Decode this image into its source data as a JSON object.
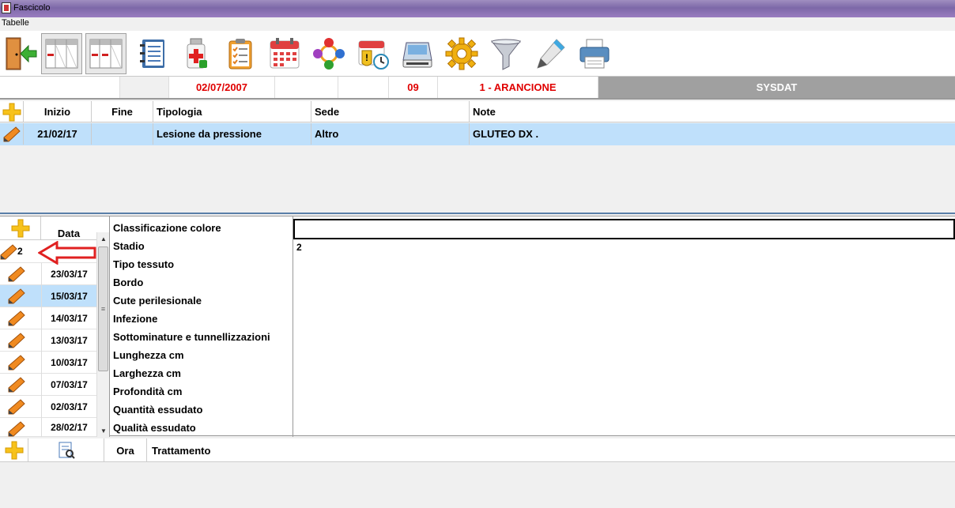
{
  "window": {
    "title": "Fascicolo"
  },
  "menu": {
    "tabelle": "Tabelle"
  },
  "toolbar": {
    "buttons": [
      "exit-icon",
      "grid-remove-icon",
      "grid-remove-icon",
      "notebook-icon",
      "medicine-bottle-icon",
      "clipboard-checklist-icon",
      "calendar-icon",
      "people-network-icon",
      "calendar-alert-clock-icon",
      "scanner-icon",
      "gear-icon",
      "filter-icon",
      "pen-icon",
      "printer-icon"
    ]
  },
  "info": {
    "date": "02/07/2007",
    "code": "09",
    "priority": "1 - ARANCIONE",
    "brand": "SYSDAT"
  },
  "lesions": {
    "headers": {
      "inizio": "Inizio",
      "fine": "Fine",
      "tipologia": "Tipologia",
      "sede": "Sede",
      "note": "Note"
    },
    "rows": [
      {
        "inizio": "21/02/17",
        "fine": "",
        "tipologia": "Lesione da pressione",
        "sede": "Altro",
        "note": "GLUTEO DX ."
      }
    ]
  },
  "assessments": {
    "header": "Data",
    "first_row_value": "2",
    "dates": [
      "23/03/17",
      "15/03/17",
      "14/03/17",
      "13/03/17",
      "10/03/17",
      "07/03/17",
      "02/03/17",
      "28/02/17"
    ],
    "selected_index": 1
  },
  "properties": [
    "Classificazione colore",
    "Stadio",
    "Tipo tessuto",
    "Bordo",
    "Cute perilesionale",
    "Infezione",
    "Sottominature e tunnellizzazioni",
    "Lunghezza cm",
    "Larghezza cm",
    "Profondità cm",
    "Quantità essudato",
    "Qualità essudato"
  ],
  "values": {
    "classificazione_colore": "",
    "stadio": "2"
  },
  "treatments": {
    "headers": {
      "ora": "Ora",
      "trattamento": "Trattamento"
    }
  },
  "colors": {
    "accent_red": "#e00000",
    "selection": "#bfe0fb",
    "brand_bg": "#a0a0a0",
    "plus": "#f7c21b"
  }
}
